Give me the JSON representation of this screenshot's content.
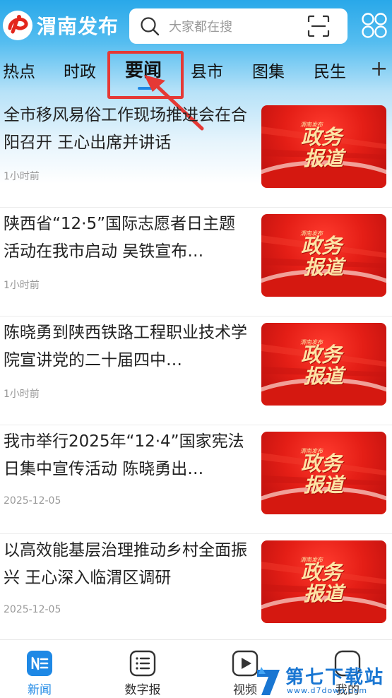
{
  "header": {
    "app_name": "渭南发布",
    "search_placeholder": "大家都在搜"
  },
  "tabs": [
    {
      "label": "热点"
    },
    {
      "label": "时政"
    },
    {
      "label": "要闻",
      "active": true
    },
    {
      "label": "县市"
    },
    {
      "label": "图集"
    },
    {
      "label": "民生"
    }
  ],
  "tab_add_label": "+",
  "news": [
    {
      "title": "全市移风易俗工作现场推进会在合阳召开  王心出席并讲话",
      "time": "1小时前"
    },
    {
      "title": "陕西省“12·5”国际志愿者日主题活动在我市启动  吴铁宣布…",
      "time": "1小时前"
    },
    {
      "title": "陈晓勇到陕西铁路工程职业技术学院宣讲党的二十届四中…",
      "time": "1小时前"
    },
    {
      "title": "我市举行2025年“12·4”国家宪法日集中宣传活动  陈晓勇出…",
      "time": "2025-12-05"
    },
    {
      "title": "以高效能基层治理推动乡村全面振兴  王心深入临渭区调研",
      "time": "2025-12-05"
    }
  ],
  "thumbnail": {
    "line1": "政务",
    "line2": "报道",
    "small": "渭南发布"
  },
  "bottom_nav": [
    {
      "label": "新闻",
      "icon": "news-icon",
      "active": true
    },
    {
      "label": "数字报",
      "icon": "digital-paper-icon"
    },
    {
      "label": "视频",
      "icon": "video-icon"
    },
    {
      "label": "我的",
      "icon": "profile-icon"
    }
  ],
  "watermark": {
    "text": "第七下载站",
    "url": "www.d7down.com"
  },
  "colors": {
    "accent": "#1e88e5",
    "header_blue": "#29a8e9",
    "annotation_red": "#e53935",
    "thumb_red": "#e41e16"
  }
}
